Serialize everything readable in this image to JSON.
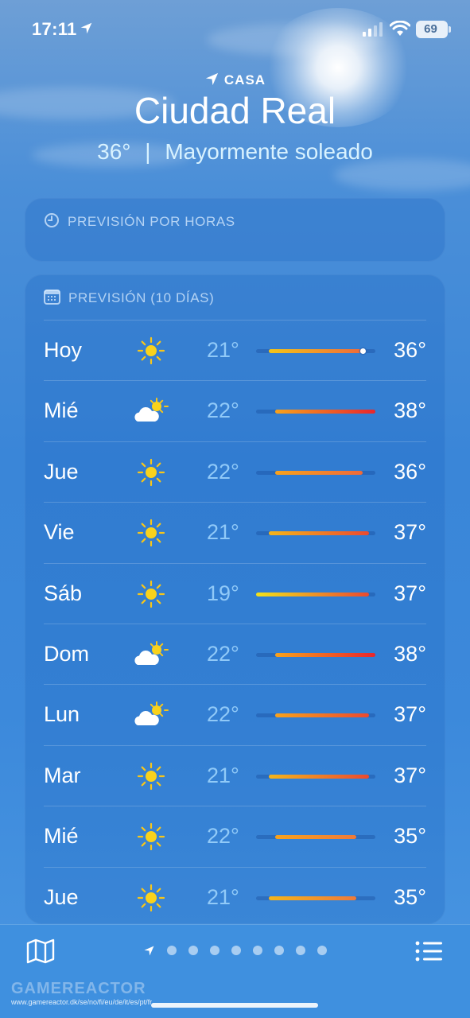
{
  "status": {
    "time": "17:11",
    "battery": "69"
  },
  "header": {
    "place_label": "CASA",
    "city": "Ciudad Real",
    "current_temp": "36°",
    "separator": "|",
    "condition": "Mayormente soleado"
  },
  "hourly": {
    "title": "PREVISIÓN POR HORAS"
  },
  "daily": {
    "title": "PREVISIÓN (10 DÍAS)",
    "range": {
      "min": 19,
      "max": 38
    },
    "days": [
      {
        "day": "Hoy",
        "icon": "sun-icon",
        "low": "21°",
        "high": "36°",
        "low_value": 21,
        "high_value": 36,
        "current": 36,
        "bar_colors": [
          "#f5c518",
          "#ee6a3a"
        ]
      },
      {
        "day": "Mié",
        "icon": "partly-cloudy-icon",
        "low": "22°",
        "high": "38°",
        "low_value": 22,
        "high_value": 38,
        "bar_colors": [
          "#f8a21c",
          "#e8262c"
        ]
      },
      {
        "day": "Jue",
        "icon": "sun-icon",
        "low": "22°",
        "high": "36°",
        "low_value": 22,
        "high_value": 36,
        "bar_colors": [
          "#f8a21c",
          "#ee6a3a"
        ]
      },
      {
        "day": "Vie",
        "icon": "sun-icon",
        "low": "21°",
        "high": "37°",
        "low_value": 21,
        "high_value": 37,
        "bar_colors": [
          "#f5b51a",
          "#ea4a30"
        ]
      },
      {
        "day": "Sáb",
        "icon": "sun-icon",
        "low": "19°",
        "high": "37°",
        "low_value": 19,
        "high_value": 37,
        "bar_colors": [
          "#f2e21a",
          "#ea4a30"
        ]
      },
      {
        "day": "Dom",
        "icon": "partly-cloudy-icon",
        "low": "22°",
        "high": "38°",
        "low_value": 22,
        "high_value": 38,
        "bar_colors": [
          "#f8a21c",
          "#e8262c"
        ]
      },
      {
        "day": "Lun",
        "icon": "partly-cloudy-icon",
        "low": "22°",
        "high": "37°",
        "low_value": 22,
        "high_value": 37,
        "bar_colors": [
          "#f8a21c",
          "#ea4a30"
        ]
      },
      {
        "day": "Mar",
        "icon": "sun-icon",
        "low": "21°",
        "high": "37°",
        "low_value": 21,
        "high_value": 37,
        "bar_colors": [
          "#f5b51a",
          "#ea4a30"
        ]
      },
      {
        "day": "Mié",
        "icon": "sun-icon",
        "low": "22°",
        "high": "35°",
        "low_value": 22,
        "high_value": 35,
        "bar_colors": [
          "#f8a21c",
          "#ee7a3a"
        ]
      },
      {
        "day": "Jue",
        "icon": "sun-icon",
        "low": "21°",
        "high": "35°",
        "low_value": 21,
        "high_value": 35,
        "bar_colors": [
          "#f5b51a",
          "#ee7a3a"
        ]
      }
    ]
  },
  "bottom": {
    "page_dots": 8,
    "map_icon": "map-icon",
    "list_icon": "list-icon",
    "location_icon": "location-arrow-icon"
  },
  "watermark": {
    "logo": "GAMEREACTOR",
    "url": "www.gamereactor.dk/se/no/fi/eu/de/it/es/pt/fr"
  }
}
